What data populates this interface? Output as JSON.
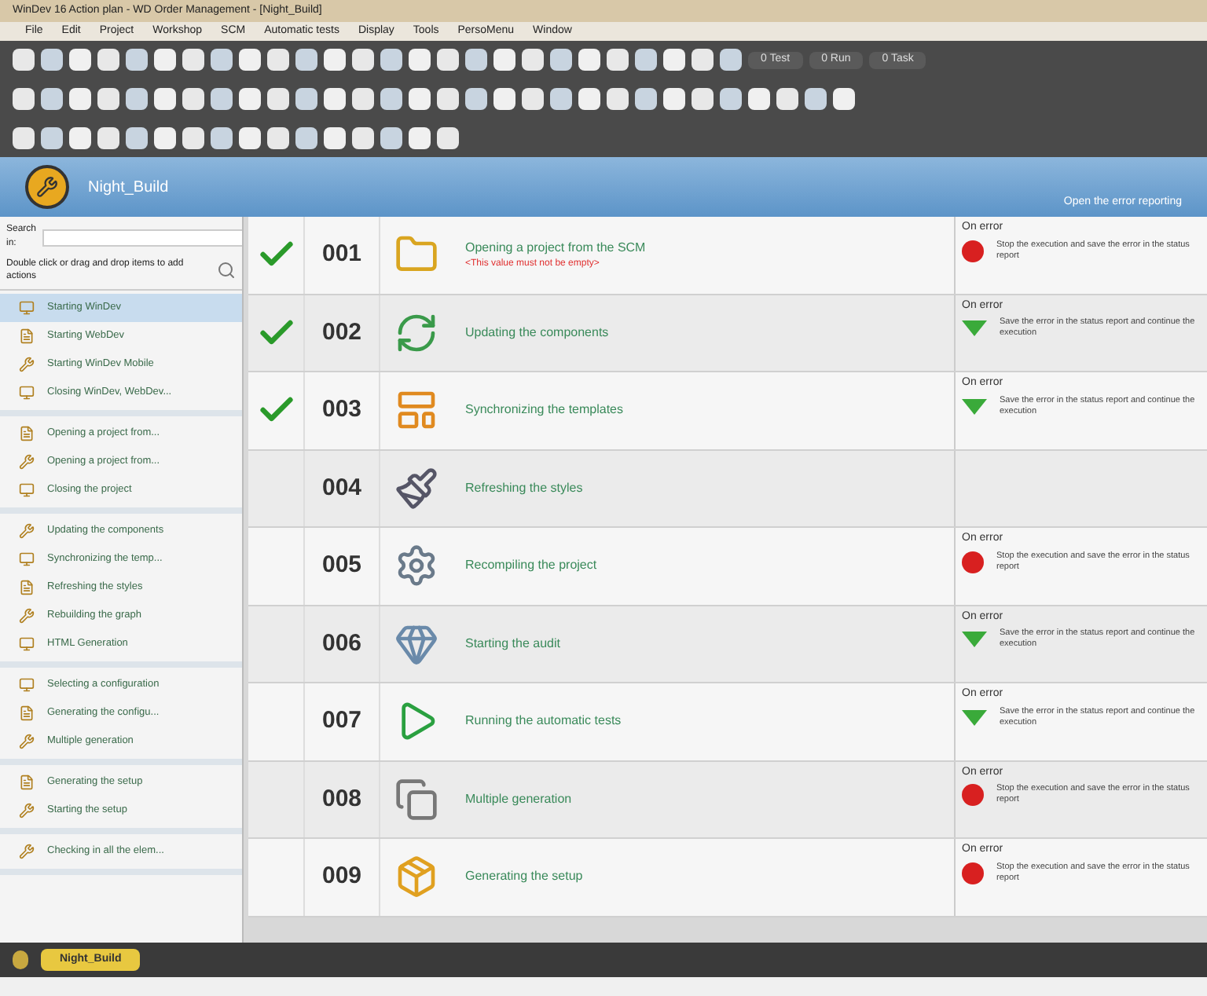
{
  "window": {
    "title": "WinDev 16 Action plan - WD Order Management - [Night_Build]"
  },
  "menu": [
    "File",
    "Edit",
    "Project",
    "Workshop",
    "SCM",
    "Automatic tests",
    "Display",
    "Tools",
    "PersoMenu",
    "Window"
  ],
  "toolbar": {
    "counters": [
      "0 Test",
      "0 Run",
      "0 Task"
    ]
  },
  "header": {
    "title": "Night_Build",
    "link": "Open the error reporting"
  },
  "sidebar": {
    "search_label": "Search in:",
    "hint": "Double click or drag and drop items to add actions",
    "groups": [
      {
        "items": [
          {
            "label": "Starting WinDev",
            "selected": true
          },
          {
            "label": "Starting WebDev",
            "selected": false
          },
          {
            "label": "Starting WinDev Mobile",
            "selected": false
          },
          {
            "label": "Closing WinDev, WebDev...",
            "selected": false
          }
        ]
      },
      {
        "items": [
          {
            "label": "Opening a project from...",
            "selected": false
          },
          {
            "label": "Opening a project from...",
            "selected": false
          },
          {
            "label": "Closing the project",
            "selected": false
          }
        ]
      },
      {
        "items": [
          {
            "label": "Updating the components",
            "selected": false
          },
          {
            "label": "Synchronizing the temp...",
            "selected": false
          },
          {
            "label": "Refreshing the styles",
            "selected": false
          },
          {
            "label": "Rebuilding the graph",
            "selected": false
          },
          {
            "label": "HTML Generation",
            "selected": false
          }
        ]
      },
      {
        "items": [
          {
            "label": "Selecting a configuration",
            "selected": false
          },
          {
            "label": "Generating the configu...",
            "selected": false
          },
          {
            "label": "Multiple generation",
            "selected": false
          }
        ]
      },
      {
        "items": [
          {
            "label": "Generating the setup",
            "selected": false
          },
          {
            "label": "Starting the setup",
            "selected": false
          }
        ]
      },
      {
        "items": [
          {
            "label": "Checking in all the elem...",
            "selected": false
          }
        ]
      }
    ]
  },
  "actions": [
    {
      "done": true,
      "number": "001",
      "title": "Opening a project from the SCM",
      "error": "<This value must not be empty>",
      "on_error": {
        "label": "On error",
        "kind": "stop",
        "text": "Stop the execution and save the error in the status report"
      }
    },
    {
      "done": true,
      "number": "002",
      "title": "Updating the components",
      "on_error": {
        "label": "On error",
        "kind": "continue",
        "text": "Save the error in the status report and continue the execution"
      }
    },
    {
      "done": true,
      "number": "003",
      "title": "Synchronizing the templates",
      "on_error": {
        "label": "On error",
        "kind": "continue",
        "text": "Save the error in the status report and continue the execution"
      }
    },
    {
      "done": false,
      "number": "004",
      "title": "Refreshing the styles"
    },
    {
      "done": false,
      "number": "005",
      "title": "Recompiling the project",
      "on_error": {
        "label": "On error",
        "kind": "stop",
        "text": "Stop the execution and save the error in the status report"
      }
    },
    {
      "done": false,
      "number": "006",
      "title": "Starting the audit",
      "on_error": {
        "label": "On error",
        "kind": "continue",
        "text": "Save the error in the status report and continue the execution"
      }
    },
    {
      "done": false,
      "number": "007",
      "title": "Running the automatic tests",
      "on_error": {
        "label": "On error",
        "kind": "continue",
        "text": "Save the error in the status report and continue the execution"
      }
    },
    {
      "done": false,
      "number": "008",
      "title": "Multiple generation",
      "on_error": {
        "label": "On error",
        "kind": "stop",
        "text": "Stop the execution and save the error in the status report"
      }
    },
    {
      "done": false,
      "number": "009",
      "title": "Generating the setup",
      "on_error": {
        "label": "On error",
        "kind": "stop",
        "text": "Stop the execution and save the error in the status report"
      }
    }
  ],
  "bottom_tabs": [
    {
      "label": "Night_Build",
      "selected": true
    }
  ]
}
